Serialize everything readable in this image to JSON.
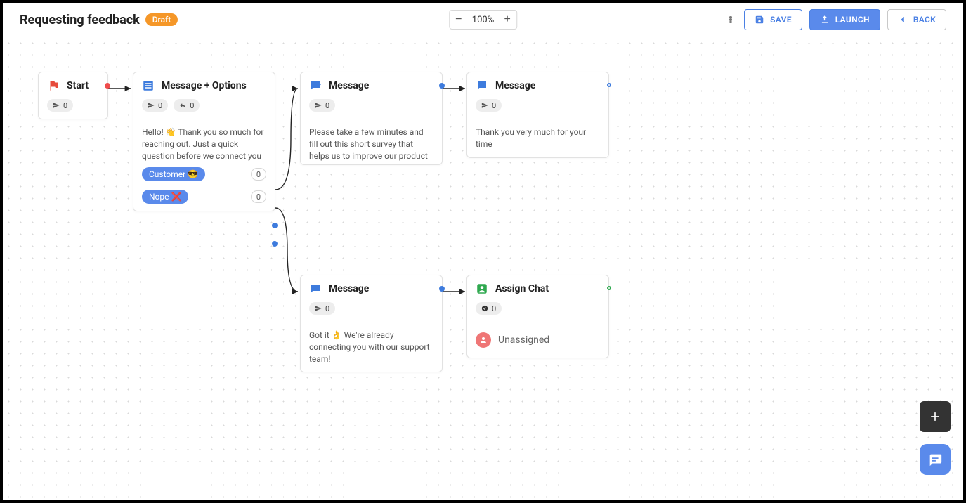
{
  "header": {
    "title": "Requesting feedback",
    "status": "Draft",
    "zoom": "100%",
    "save": "SAVE",
    "launch": "LAUNCH",
    "back": "BACK"
  },
  "nodes": {
    "start": {
      "title": "Start",
      "sent": "0"
    },
    "msgopt": {
      "title": "Message + Options",
      "sent": "0",
      "replies": "0",
      "body": "Hello! 👋 Thank you so much for reaching out. Just a quick question before we connect you with a support agent. Are you our customer",
      "opts": [
        {
          "label": "Customer 😎",
          "count": "0"
        },
        {
          "label": "Nope ❌",
          "count": "0"
        }
      ]
    },
    "msg1": {
      "title": "Message",
      "sent": "0",
      "body": "Please take a few minutes and fill out this short survey that helps us to improve our product and customer service"
    },
    "msg2": {
      "title": "Message",
      "sent": "0",
      "body": "Thank you very much for your time"
    },
    "msg3": {
      "title": "Message",
      "sent": "0",
      "body": "Got it 👌 We're already connecting you with our support team!"
    },
    "assign": {
      "title": "Assign Chat",
      "done": "0",
      "status": "Unassigned"
    }
  }
}
